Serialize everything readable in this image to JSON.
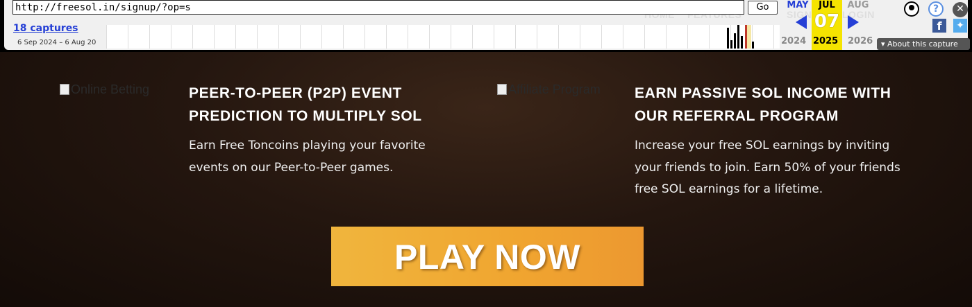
{
  "wayback": {
    "url": "http://freesol.in/signup/?op=s",
    "go_label": "Go",
    "captures_label": "18 captures",
    "date_range": "6 Sep 2024 – 6 Aug 20",
    "prev_month": "MAY",
    "current_month": "JUL",
    "current_day": "07",
    "next_month": "AUG",
    "prev_year": "2024",
    "current_year": "2025",
    "next_year": "2026",
    "about_label": "About this capture",
    "colors": {
      "link": "#2640d6",
      "highlight": "#f5e400"
    }
  },
  "site_nav_ghost": {
    "home": "HOME",
    "features": "FEATURES",
    "sign": "SIGN",
    "login": "LOGIN"
  },
  "features": [
    {
      "image_alt": "Online Betting",
      "title_line1": "PEER-TO-PEER (P2P) EVENT",
      "title_line2": "PREDICTION TO MULTIPLY SOL",
      "desc_line1": "Earn Free Toncoins playing your favorite",
      "desc_line2": "events on our Peer-to-Peer games."
    },
    {
      "image_alt": "Affiliate Program",
      "title_line1": "EARN PASSIVE SOL INCOME WITH",
      "title_line2": "OUR REFERRAL PROGRAM",
      "desc_line1": "Increase your free SOL earnings by inviting",
      "desc_line2": "your friends to join. Earn 50% of your friends",
      "desc_line3": "free SOL earnings for a lifetime."
    }
  ],
  "cta": {
    "label": "PLAY NOW",
    "color_start": "#f0b53d",
    "color_end": "#ec9830"
  }
}
